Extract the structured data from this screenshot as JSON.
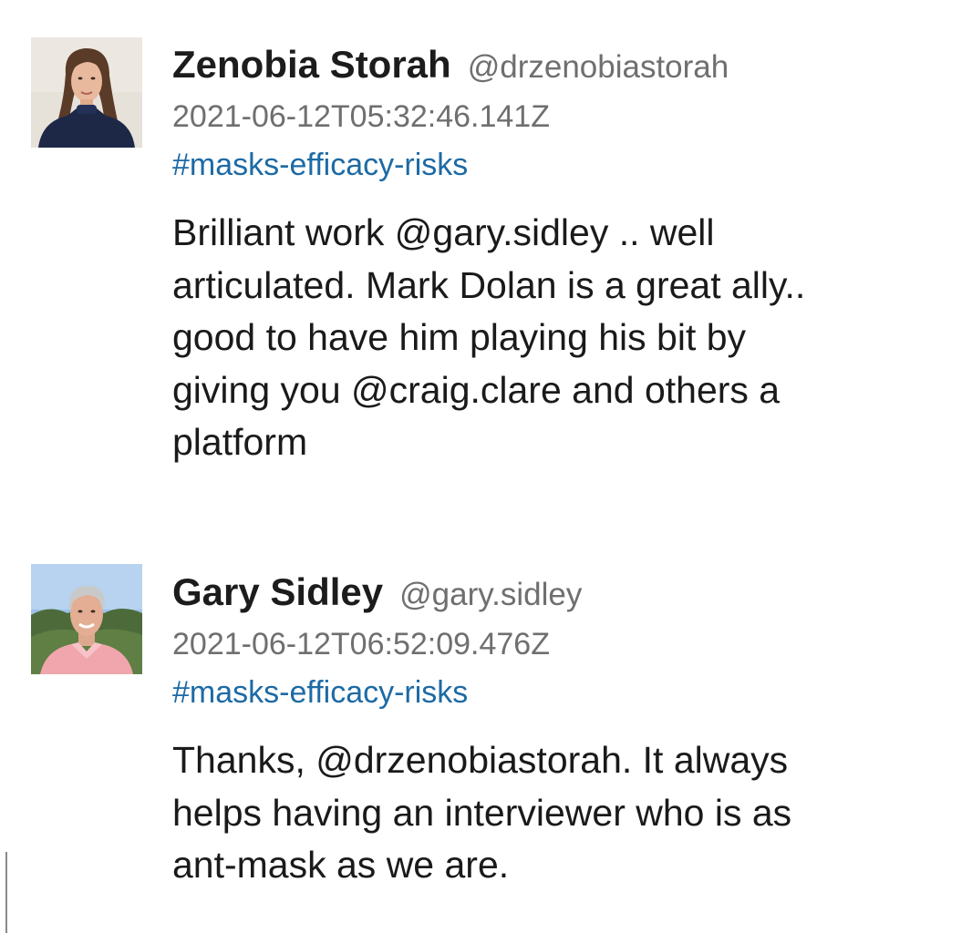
{
  "posts": [
    {
      "author_name": "Zenobia Storah",
      "author_handle": "@drzenobiastorah",
      "timestamp": "2021-06-12T05:32:46.141Z",
      "channel": "#masks-efficacy-risks",
      "message_lines": [
        "Brilliant work @gary.sidley .. well",
        "articulated. Mark Dolan is a great ally..",
        "good to have him playing his bit by",
        "giving you @craig.clare and others a",
        "platform"
      ]
    },
    {
      "author_name": "Gary Sidley",
      "author_handle": "@gary.sidley",
      "timestamp": "2021-06-12T06:52:09.476Z",
      "channel": "#masks-efficacy-risks",
      "message_lines": [
        "Thanks, @drzenobiastorah. It always",
        "helps having an interviewer who is as",
        "ant-mask as we are."
      ]
    }
  ],
  "colors": {
    "name": "#1c1c1c",
    "meta": "#6f6f6f",
    "channel_link": "#1d6aa5",
    "body": "#1a1a1a",
    "background": "#ffffff"
  }
}
